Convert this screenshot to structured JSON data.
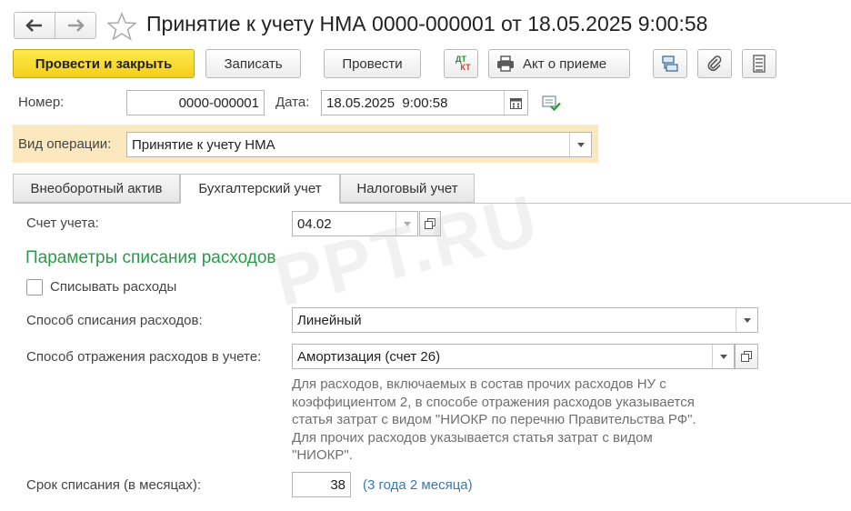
{
  "window": {
    "title": "Принятие к учету НМА 0000-000001 от 18.05.2025 9:00:58"
  },
  "toolbar": {
    "post_close_label": "Провести и закрыть",
    "save_label": "Записать",
    "post_label": "Провести",
    "dtkt_top": "ДТ",
    "dtkt_bottom": "КТ",
    "act_label": "Акт о приеме"
  },
  "header": {
    "number_label": "Номер:",
    "number_value": "0000-000001",
    "date_label": "Дата:",
    "date_value": "18.05.2025  9:00:58",
    "operation_label": "Вид операции:",
    "operation_value": "Принятие к учету НМА"
  },
  "tabs": [
    {
      "label": "Внеоборотный актив"
    },
    {
      "label": "Бухгалтерский учет"
    },
    {
      "label": "Налоговый учет"
    }
  ],
  "accounting": {
    "account_label": "Счет учета:",
    "account_value": "04.02",
    "section_title": "Параметры списания расходов",
    "writeoff_checkbox_label": "Списывать расходы",
    "method_label": "Способ списания расходов:",
    "method_value": "Линейный",
    "reflection_label": "Способ отражения расходов в учете:",
    "reflection_value": "Амортизация (счет 26)",
    "hint_lines": [
      "Для расходов, включаемых в состав прочих расходов НУ с",
      "коэффициентом 2, в способе отражения расходов указывается",
      "статья затрат с видом \"НИОКР по перечню Правительства РФ\".",
      "Для прочих расходов указывается статья затрат с видом",
      "\"НИОКР\"."
    ],
    "term_label": "Срок списания (в месяцах):",
    "term_value": "38",
    "term_description": "(3 года 2 месяца)"
  },
  "watermark": "PPT.RU",
  "colors": {
    "primary_button": "#f4cf1a",
    "section_title": "#2a9a4a",
    "operation_highlight": "#fbe8bf",
    "term_description": "#3a78b0"
  }
}
